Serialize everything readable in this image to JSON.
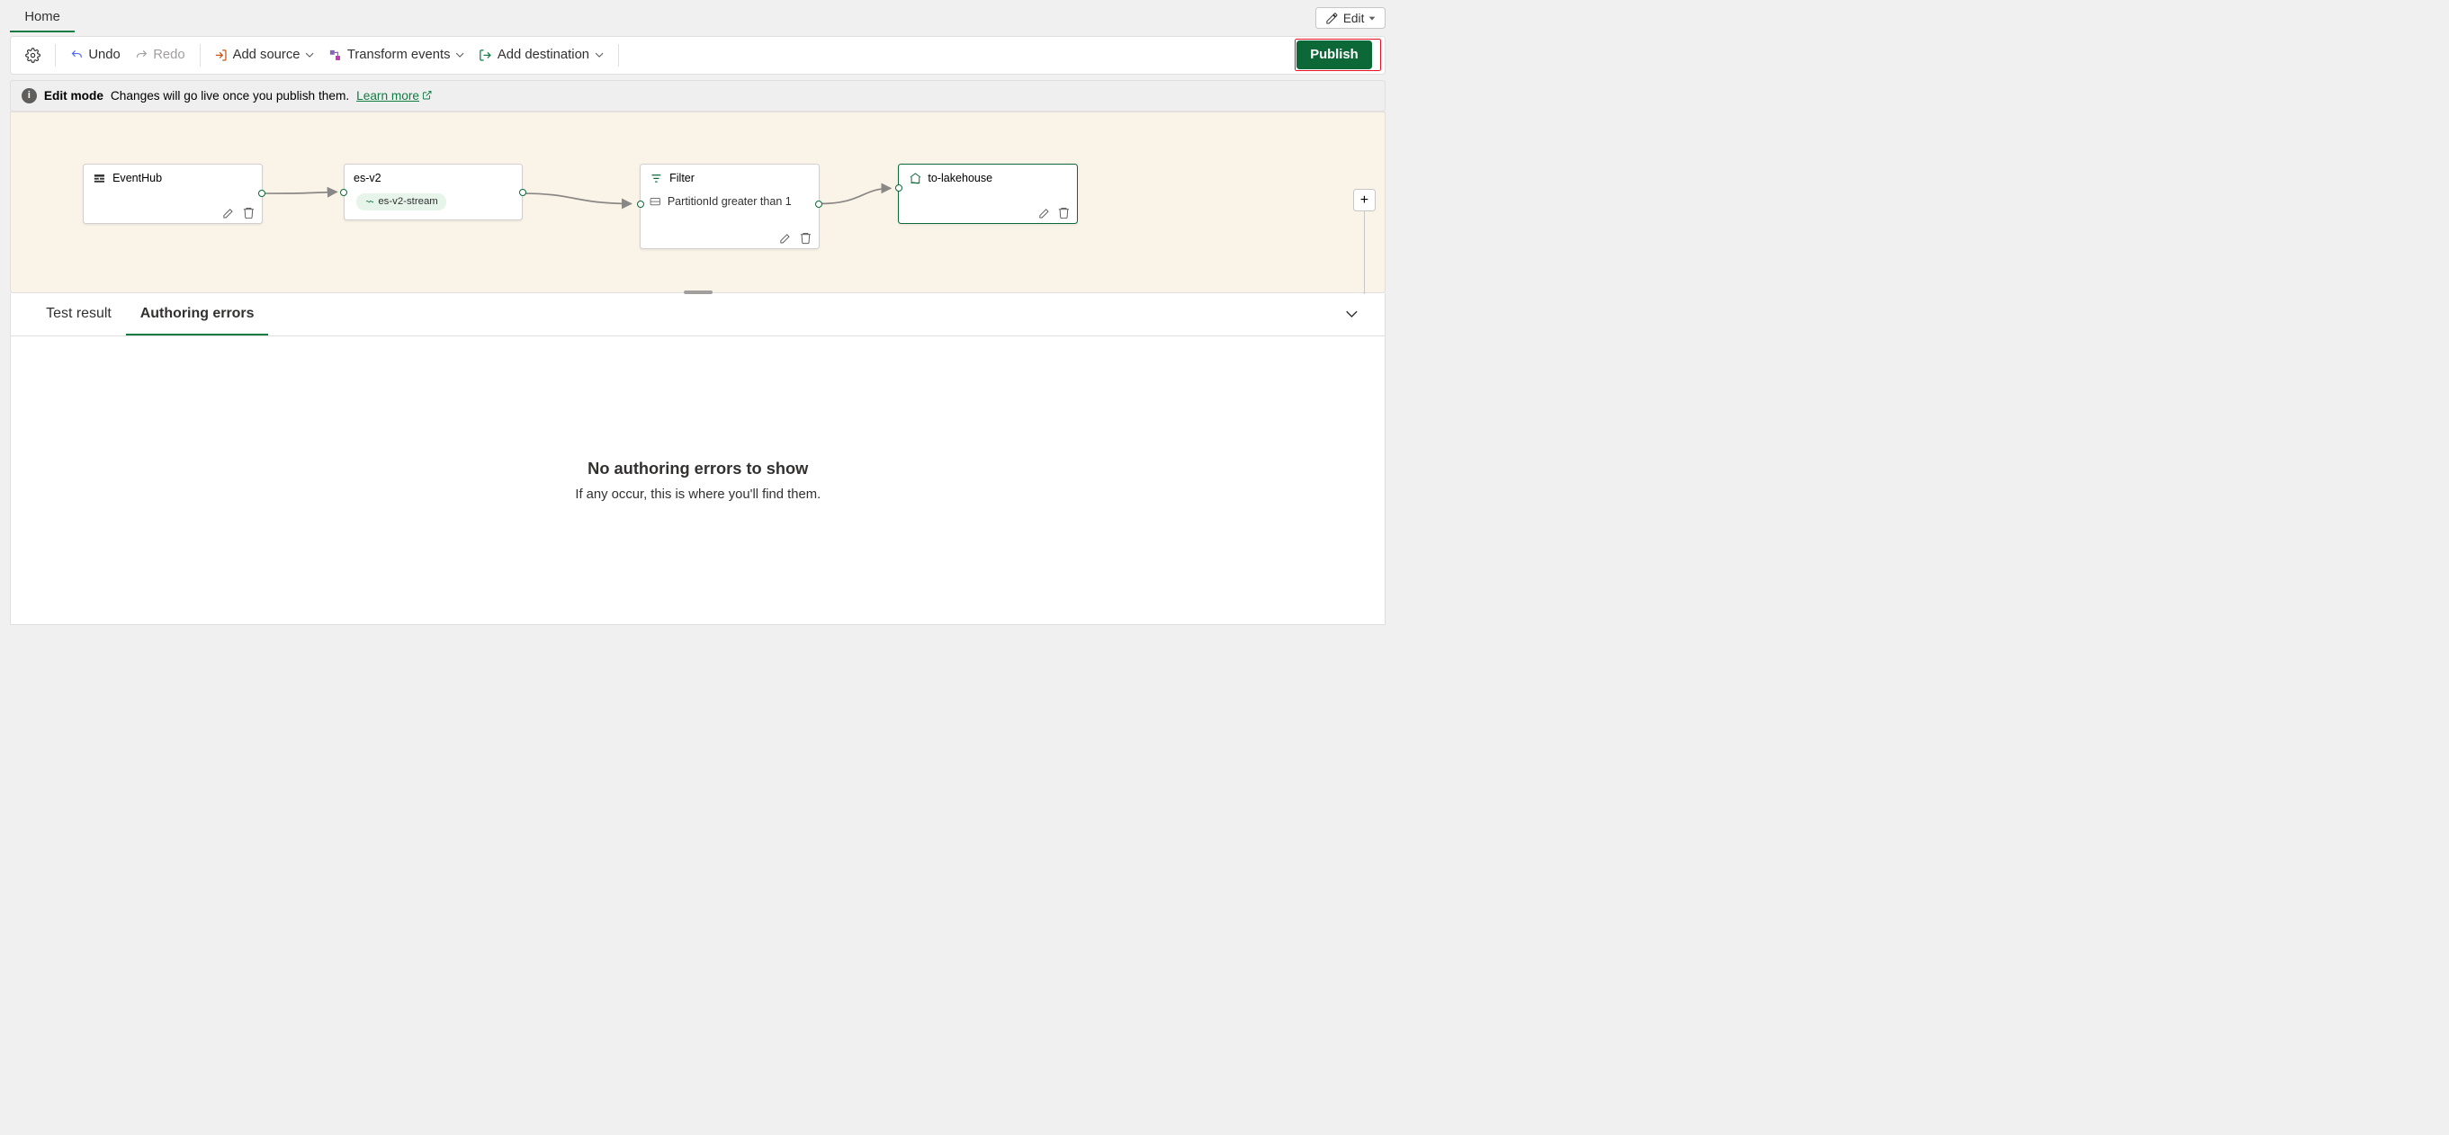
{
  "ribbon": {
    "tabs": {
      "home": "Home"
    },
    "edit_label": "Edit"
  },
  "toolbar": {
    "undo": "Undo",
    "redo": "Redo",
    "add_source": "Add source",
    "transform": "Transform events",
    "add_destination": "Add destination",
    "publish": "Publish"
  },
  "info_bar": {
    "title": "Edit mode",
    "desc": "Changes will go live once you publish them.",
    "learn_more": "Learn more"
  },
  "canvas": {
    "nodes": {
      "eventhub": {
        "title": "EventHub"
      },
      "esv2": {
        "title": "es-v2",
        "stream": "es-v2-stream"
      },
      "filter": {
        "title": "Filter",
        "condition": "PartitionId greater than 1"
      },
      "lakehouse": {
        "title": "to-lakehouse"
      }
    }
  },
  "bottom_panel": {
    "tabs": {
      "test_result": "Test result",
      "authoring_errors": "Authoring errors"
    },
    "empty_title": "No authoring errors to show",
    "empty_desc": "If any occur, this is where you'll find them."
  }
}
